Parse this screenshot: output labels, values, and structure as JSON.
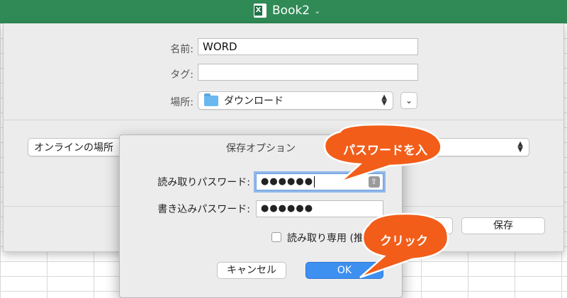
{
  "app": {
    "title": "Book2"
  },
  "save_sheet": {
    "name_label": "名前:",
    "name_value": "WORD",
    "tags_label": "タグ:",
    "tags_value": "",
    "location_label": "場所:",
    "location_value": "ダウンロード",
    "online_location_label": "オンラインの場所",
    "save_button": "保存"
  },
  "options_dialog": {
    "title": "保存オプション",
    "read_password_label": "読み取りパスワード:",
    "read_password_value": "●●●●●●",
    "write_password_label": "書き込みパスワード:",
    "write_password_value": "●●●●●●",
    "readonly_label": "読み取り専用 (推",
    "readonly_checked": false,
    "cancel_button": "キャンセル",
    "ok_button": "OK"
  },
  "annotations": {
    "callout_password": "パスワードを入",
    "callout_click": "クリック",
    "callout_color": "#f25d1a"
  }
}
